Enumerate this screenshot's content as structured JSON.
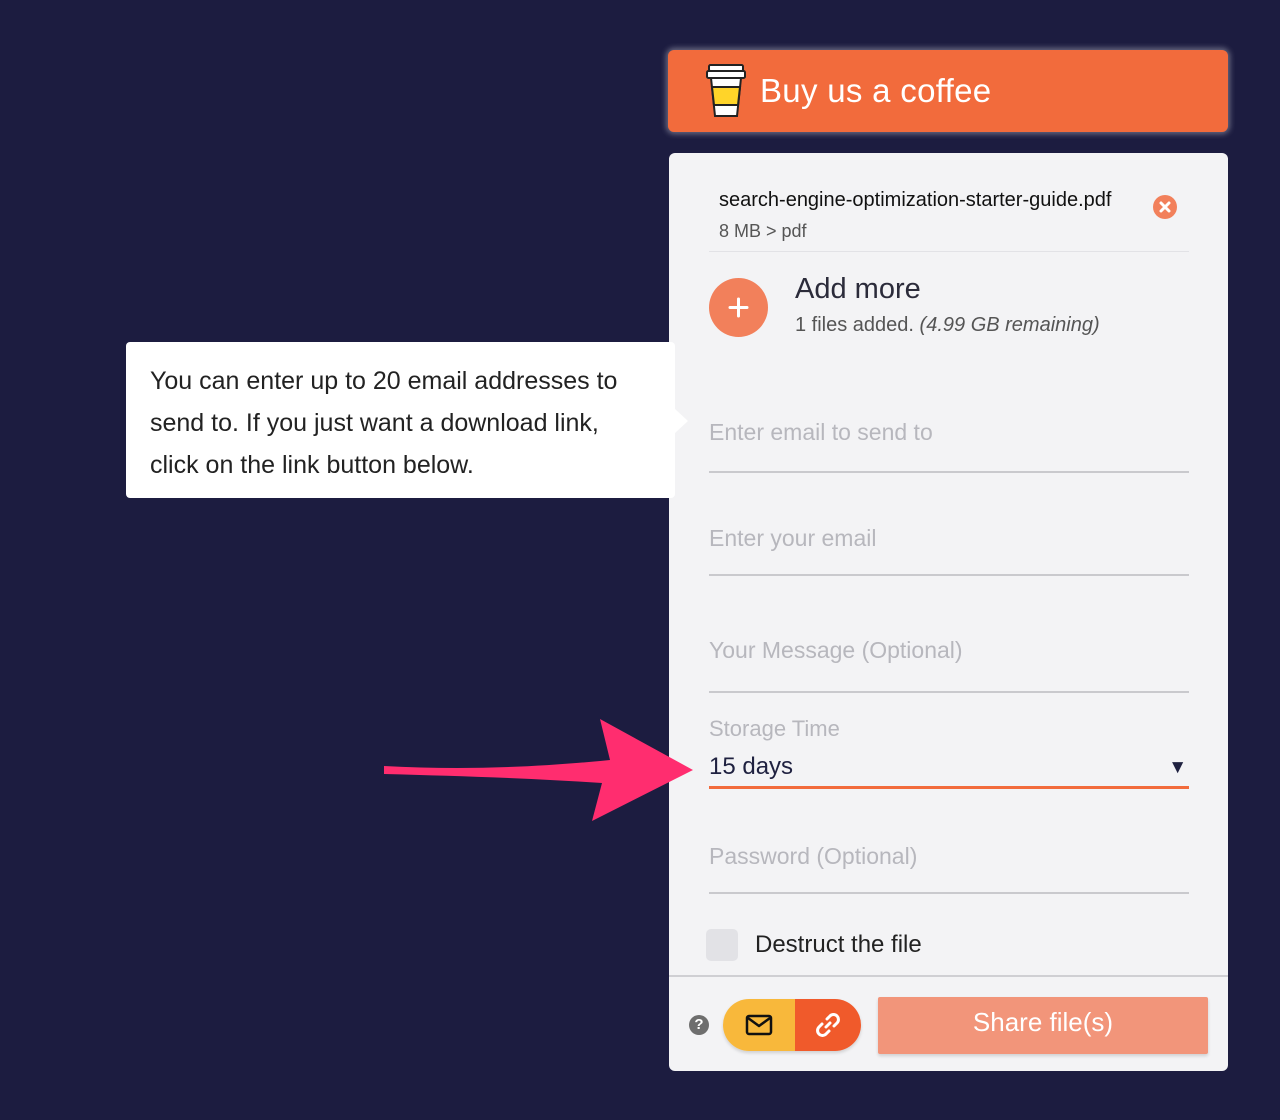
{
  "coffee": {
    "label": "Buy us a coffee"
  },
  "file": {
    "name": "search-engine-optimization-starter-guide.pdf",
    "meta": "8 MB > pdf"
  },
  "add_more": {
    "title": "Add more",
    "count": "1 files added.",
    "remaining": "(4.99 GB remaining)"
  },
  "form": {
    "email_to_placeholder": "Enter email to send to",
    "email_from_placeholder": "Enter your email",
    "message_placeholder": "Your Message (Optional)",
    "storage_label": "Storage Time",
    "storage_value": "15 days",
    "password_placeholder": "Password (Optional)",
    "destruct_label": "Destruct the file"
  },
  "footer": {
    "share_label": "Share file(s)",
    "help_icon": "?"
  },
  "tooltip": {
    "text": "You can enter up to 20 email addresses to send to. If you just want a download link, click on the link button below."
  },
  "icons": {
    "coffee": "coffee-cup-icon",
    "remove": "close-circle-icon",
    "add": "plus-icon",
    "dropdown": "chevron-down-icon",
    "email": "envelope-icon",
    "link": "link-icon",
    "help": "question-circle-icon"
  },
  "colors": {
    "background": "#1c1c40",
    "accent": "#f26b3c",
    "share_button": "#f2957a",
    "email_mode": "#f8b83b",
    "link_mode": "#f05a2b",
    "annotation_arrow": "#ff2d6f"
  }
}
